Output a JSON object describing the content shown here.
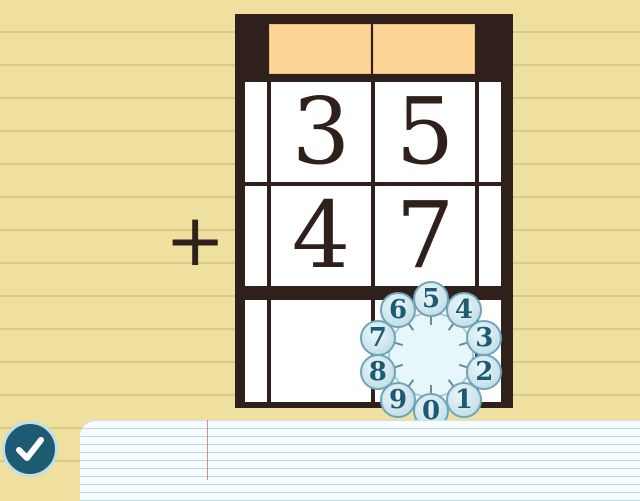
{
  "operator": "+",
  "problem": {
    "top_digits": [
      "3",
      "5"
    ],
    "bottom_digits": [
      "4",
      "7"
    ],
    "answer_digits": [
      "",
      ""
    ]
  },
  "dial": {
    "numbers": [
      "5",
      "4",
      "3",
      "2",
      "1",
      "0",
      "9",
      "8",
      "7",
      "6"
    ]
  },
  "check_button": {
    "icon": "check-icon"
  },
  "colors": {
    "background": "#efe0a0",
    "board": "#2f201c",
    "carry_box": "#fdd597",
    "dial_number": "#1e5a72",
    "check_button": "#1e5a72"
  }
}
